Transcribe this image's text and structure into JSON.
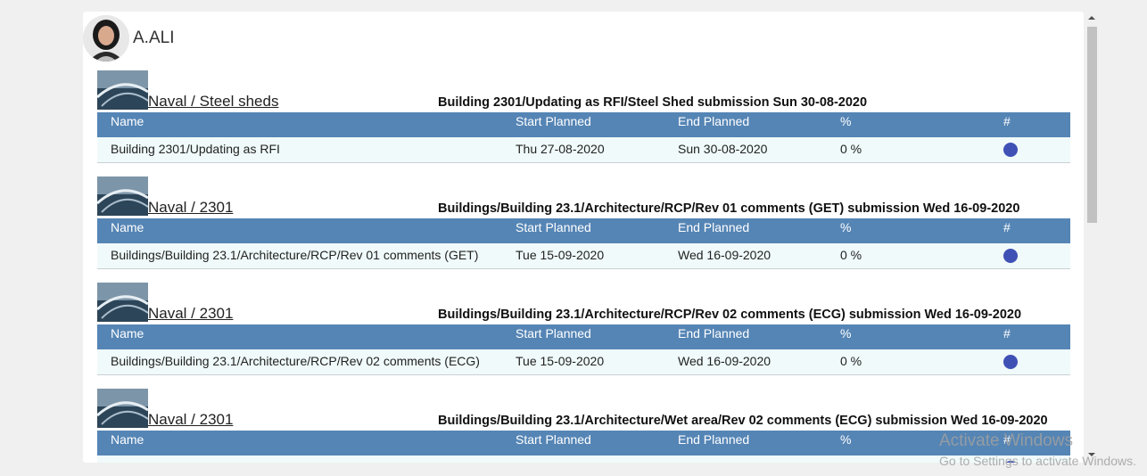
{
  "user": {
    "name": "A.ALI"
  },
  "columns": {
    "name": "Name",
    "start": "Start Planned",
    "end": "End Planned",
    "pct": "%",
    "hash": "#"
  },
  "sections": [
    {
      "project": "Naval / Steel sheds",
      "title": "Building 2301/Updating as RFI/Steel Shed submission Sun 30-08-2020",
      "row": {
        "name": "Building 2301/Updating as RFI",
        "start": "Thu 27-08-2020",
        "end": "Sun 30-08-2020",
        "pct": "0 %"
      }
    },
    {
      "project": "Naval / 2301",
      "title": "Buildings/Building 23.1/Architecture/RCP/Rev 01 comments (GET) submission Wed 16-09-2020",
      "row": {
        "name": "Buildings/Building 23.1/Architecture/RCP/Rev 01 comments (GET)",
        "start": "Tue 15-09-2020",
        "end": "Wed 16-09-2020",
        "pct": "0 %"
      }
    },
    {
      "project": "Naval / 2301",
      "title": "Buildings/Building 23.1/Architecture/RCP/Rev 02 comments (ECG) submission Wed 16-09-2020",
      "row": {
        "name": "Buildings/Building 23.1/Architecture/RCP/Rev 02 comments (ECG)",
        "start": "Tue 15-09-2020",
        "end": "Wed 16-09-2020",
        "pct": "0 %"
      }
    },
    {
      "project": "Naval / 2301",
      "title": "Buildings/Building 23.1/Architecture/Wet area/Rev 02 comments (ECG) submission Wed 16-09-2020",
      "row": {
        "name": "",
        "start": "",
        "end": "",
        "pct": ""
      }
    }
  ],
  "watermark": {
    "line1": "Activate Windows",
    "line2": "Go to Settings to activate Windows."
  },
  "colors": {
    "header": "#5585b5",
    "row_bg": "#f0fafa",
    "status_dot": "#3f51b5"
  }
}
